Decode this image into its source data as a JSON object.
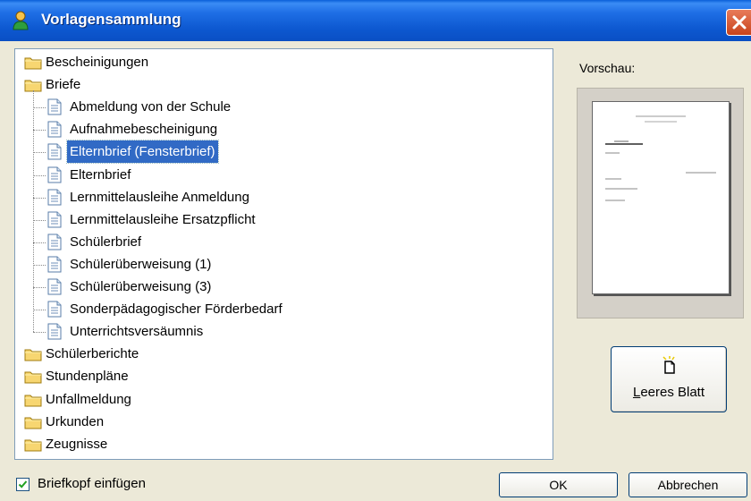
{
  "window": {
    "title": "Vorlagensammlung"
  },
  "tree": {
    "folders_top": [
      {
        "label": "Bescheinigungen"
      },
      {
        "label": "Briefe"
      }
    ],
    "briefe_children": [
      {
        "label": "Abmeldung von der Schule"
      },
      {
        "label": "Aufnahmebescheinigung"
      },
      {
        "label": "Elternbrief (Fensterbrief)",
        "selected": true
      },
      {
        "label": "Elternbrief"
      },
      {
        "label": "Lernmittelausleihe Anmeldung"
      },
      {
        "label": "Lernmittelausleihe Ersatzpflicht"
      },
      {
        "label": "Schülerbrief"
      },
      {
        "label": "Schülerüberweisung (1)"
      },
      {
        "label": "Schülerüberweisung (3)"
      },
      {
        "label": "Sonderpädagogischer Förderbedarf"
      },
      {
        "label": "Unterrichtsversäumnis"
      }
    ],
    "folders_bottom": [
      {
        "label": "Schülerberichte"
      },
      {
        "label": "Stundenpläne"
      },
      {
        "label": "Unfallmeldung"
      },
      {
        "label": "Urkunden"
      },
      {
        "label": "Zeugnisse"
      }
    ]
  },
  "preview": {
    "label": "Vorschau:"
  },
  "leeres_blatt": {
    "label": "Leeres Blatt"
  },
  "footer": {
    "checkbox_label": "Briefkopf einfügen",
    "checkbox_checked": true,
    "ok_label": "OK",
    "cancel_label": "Abbrechen"
  },
  "colors": {
    "titlebar": "#0a58d0",
    "selection": "#316ac5"
  }
}
